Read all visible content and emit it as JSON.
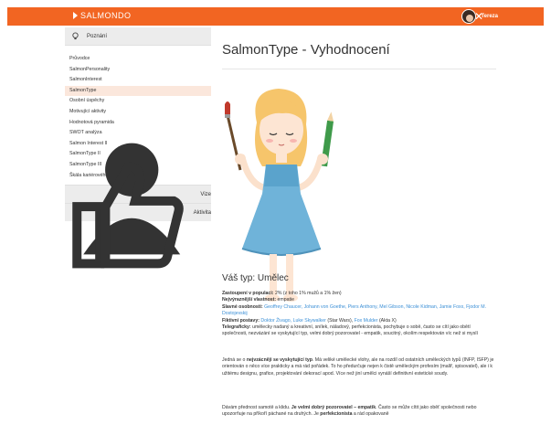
{
  "header": {
    "brand": "SALMONDO",
    "user_name": "Tereza",
    "tools_icon": "wrench-screwdriver-icon"
  },
  "sidebar": {
    "section_poznani": "Poznání",
    "items": [
      {
        "label": "Průvodce"
      },
      {
        "label": "SalmonPersonality"
      },
      {
        "label": "SalmonInterest"
      },
      {
        "label": "SalmonType"
      },
      {
        "label": "Osobní úspěchy"
      },
      {
        "label": "Motivující aktivity"
      },
      {
        "label": "Hodnotová pyramida"
      },
      {
        "label": "SWOT analýza"
      },
      {
        "label": "Salmon Interest II"
      },
      {
        "label": "SalmonType II"
      },
      {
        "label": "SalmonType III"
      },
      {
        "label": "Škála kariérového rozhodování"
      }
    ],
    "section_vize": "Vize",
    "section_aktivita": "Aktivita"
  },
  "main": {
    "title": "SalmonType - Vyhodnocení",
    "type_heading": "Váš typ: Umělec",
    "zastoupeni_label": "Zastoupení v populaci:",
    "zastoupeni_value": " 2% (z toho 1% mužů a 1% žen)",
    "vlastnost_label": "Nejvýraznější vlastnost:",
    "vlastnost_value": " empatie",
    "osobnosti_label": "Slavné osobnosti:",
    "osobnosti_links": "Geoffrey Chaucer, Johann von Goethe, Piers Anthony, Mel Gibson, Nicole Kidman, Jamie Foxx, Fjodor M. Dostojevskij",
    "postavy_label": "Fiktivní postavy:",
    "postavy_link1": "Doktor Živago, Luke Skywalker",
    "postavy_mid": " (Star Wars), ",
    "postavy_link2": "Fox Mulder",
    "postavy_end": " (Akta X)",
    "telegraficky_label": "Telegraficky:",
    "telegraficky_value": " umělecky nadaný a kreativní, snílek, náladový, perfekcionista, pochybuje o sobě, často se cítí jako obětí společnosti, nezvázání se vyskytující typ, velmi dobrý pozorovatel - empatik, soucitný, okolím respektován víc než si myslí",
    "para1_a": "Jedná se o ",
    "para1_b": "nejvzácněji se vyskytující typ",
    "para1_c": ". Má veliké umělecké vlohy, ale na rozdíl od ostatních uměleckých typů (INFP, ISFP) je orientován o něco více prakticky a má rád pořádek. To ho předurčuje nejen k čistě uměleckým profesím (malíř, spisovatel), ale i k užitému designu, grafice, projektování dekorací apod. Více než jiní umělci vynáší definitivní estetické soudy.",
    "para2_a": "Dávám přednost samotě a klidu. ",
    "para2_b": "Je velmi dobrý pozorovatel – empatik",
    "para2_c": ". Často se může cítit jako oběť společnosti nebo upozorňuje na příkoří páchané na druhých. Je ",
    "para2_d": "perfekcionista",
    "para2_e": " a rád opakovaně"
  }
}
